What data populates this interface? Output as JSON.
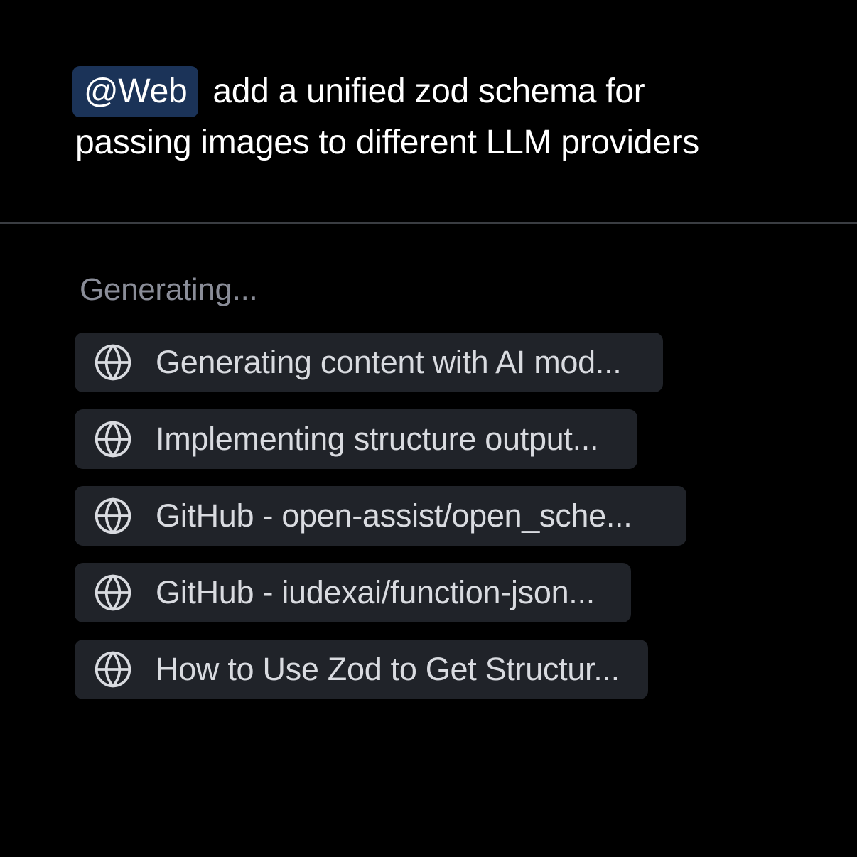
{
  "prompt": {
    "mention": "@Web",
    "line1": "add a unified zod schema for",
    "line2": "passing images to different LLM providers"
  },
  "status": {
    "text": "Generating..."
  },
  "results": {
    "icon": "globe-icon",
    "items": [
      {
        "label": "Generating content with AI mod..."
      },
      {
        "label": "Implementing structure output..."
      },
      {
        "label": "GitHub - open-assist/open_sche..."
      },
      {
        "label": "GitHub - iudexai/function-json..."
      },
      {
        "label": "How to Use Zod to Get Structur..."
      }
    ]
  },
  "colors": {
    "background": "#000000",
    "mention_bg": "#1b3358",
    "card_bg": "#202329",
    "status_text": "#8a8d98",
    "card_text": "#d9dbe0"
  }
}
